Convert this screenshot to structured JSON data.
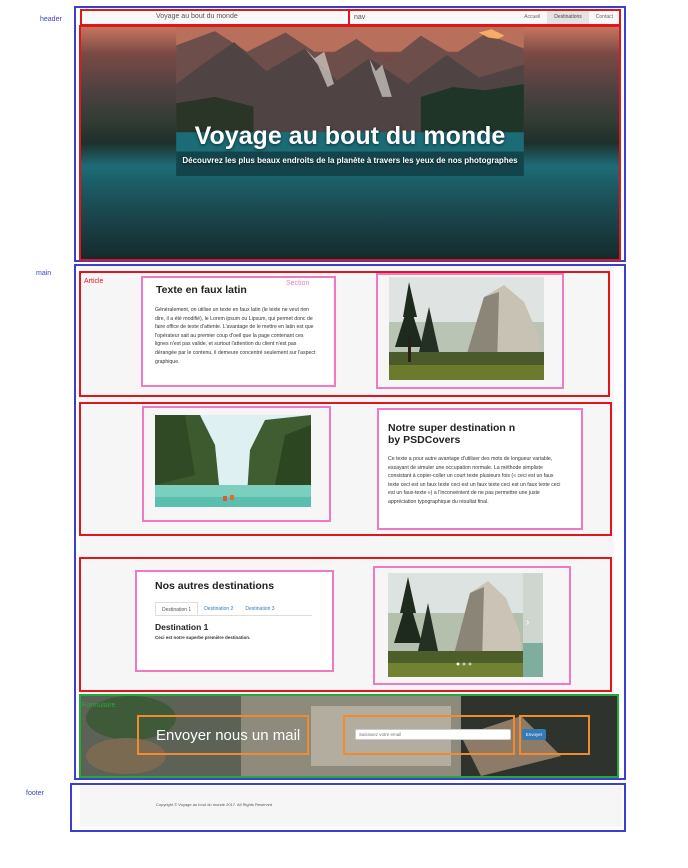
{
  "annotations": {
    "header": "header",
    "main": "main",
    "footer": "footer",
    "nav": "nav",
    "article": "Article",
    "section": "Section",
    "formulaire": "Formulaire"
  },
  "header": {
    "brand": "Voyage au bout du monde",
    "nav_links": [
      "Accueil",
      "Destinations",
      "Contact"
    ],
    "active_nav": "Destinations"
  },
  "hero": {
    "title": "Voyage au bout du monde",
    "subtitle": "Découvrez les plus beaux endroits de la planète à travers les yeux de nos photographes"
  },
  "article1": {
    "title": "Texte en faux latin",
    "paragraph": "Généralement, on utilise un texte en faux latin (le texte ne veut rien dire, il a été modifié), le Lorem ipsum ou Lipsum, qui permet donc de faire office de texte d'attente. L'avantage de le mettre en latin est que l'opérateur sait au premier coup d'oeil que la page contenant ces lignes n'est pas valide, et surtout l'attention du client n'est pas dérangée par le contenu, il demeure concentré seulement sur l'aspect graphique."
  },
  "article2": {
    "title_line1": "Notre super destination n",
    "title_line2": "by PSDCovers",
    "paragraph": "Ce texte a pour autre avantage d'utiliser des mots de longueur variable, essayant de simuler une occupation normale. La méthode simpliste consistant à copier-coller un court texte plusieurs fois (« ceci est un faux texte ceci est un faux texte ceci est un faux texte ceci est un faux texte ceci est un faux-texte ») a l'inconvénient de ne pas permettre une juste appréciation typographique du résultat final."
  },
  "article3": {
    "title": "Nos autres destinations",
    "tabs": [
      "Destination 1",
      "Destination 2",
      "Destination 3"
    ],
    "active_tab": "Destination 1",
    "pane_title": "Destination 1",
    "pane_text": "Ceci est notre superbe première destination."
  },
  "form": {
    "title": "Envoyer nous un mail",
    "email_placeholder": "Saisissez votre email",
    "submit_label": "Envoyer"
  },
  "footer": {
    "copyright": "Copyright © Voyage au bout du monde 2017. All Rights Reserved"
  }
}
